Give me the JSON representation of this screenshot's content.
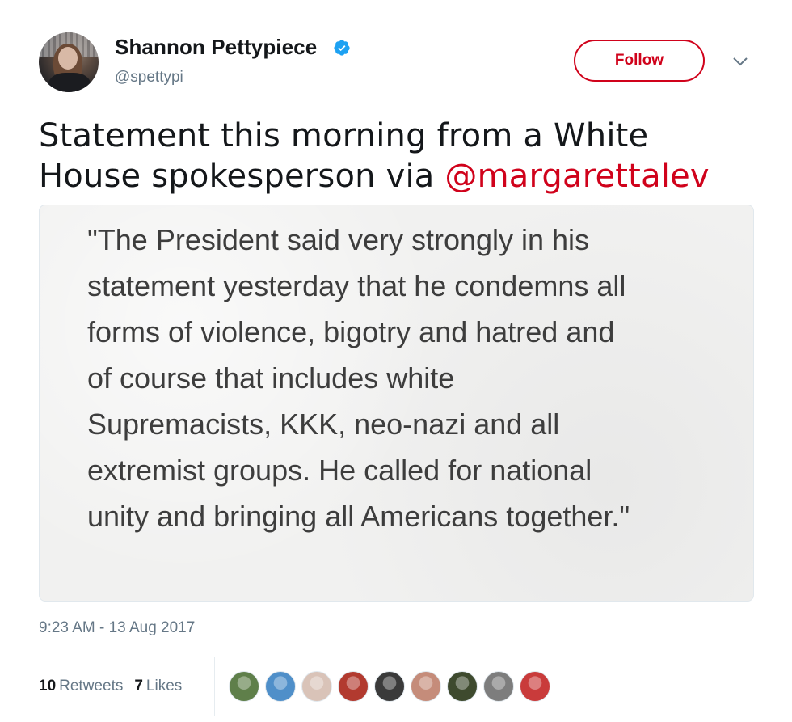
{
  "author": {
    "name": "Shannon Pettypiece",
    "handle": "@spettypi"
  },
  "actions": {
    "follow_label": "Follow"
  },
  "tweet": {
    "text_before": "Statement this morning from a White House spokesperson via ",
    "mention": "@margarettalev",
    "quote_image_text": "\"The President said very strongly in his\nstatement yesterday that he condemns all\nforms of violence, bigotry and hatred and\nof course that includes white\nSupremacists, KKK, neo-nazi and all\nextremist groups. He called for national\nunity and bringing all Americans together.\"",
    "timestamp": "9:23 AM - 13 Aug 2017"
  },
  "stats": {
    "retweets_count": "10",
    "retweets_label": "Retweets",
    "likes_count": "7",
    "likes_label": "Likes"
  },
  "likers": [
    {
      "icon": "liker-avatar-1",
      "color": "#5f7f4a"
    },
    {
      "icon": "liker-avatar-2",
      "color": "#4f8fc9"
    },
    {
      "icon": "liker-avatar-3",
      "color": "#d9c3b8"
    },
    {
      "icon": "liker-avatar-4",
      "color": "#b23a2f"
    },
    {
      "icon": "liker-avatar-5",
      "color": "#3a3a3a"
    },
    {
      "icon": "liker-avatar-6",
      "color": "#c58c7a"
    },
    {
      "icon": "liker-avatar-7",
      "color": "#3e4a2e"
    },
    {
      "icon": "liker-avatar-8",
      "color": "#7d7d7d"
    },
    {
      "icon": "liker-avatar-9",
      "color": "#c93b3b"
    }
  ],
  "colors": {
    "accent": "#d0021b",
    "verified": "#1da1f2",
    "secondary_text": "#657786"
  }
}
